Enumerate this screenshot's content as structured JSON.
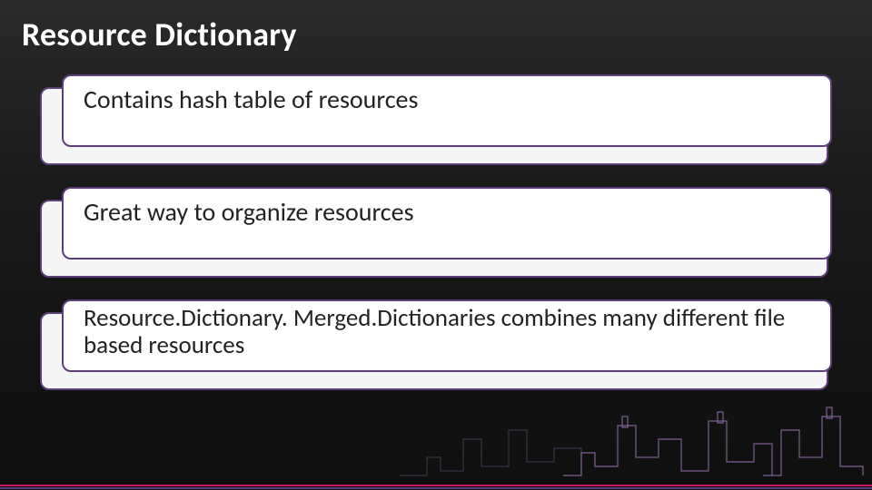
{
  "title": "Resource Dictionary",
  "bullets": [
    {
      "text": "Contains hash table of resources"
    },
    {
      "text": "Great way to organize resources"
    },
    {
      "text": "Resource.Dictionary. Merged.Dictionaries combines many different file based resources"
    }
  ],
  "colors": {
    "accent_purple": "#5d4079",
    "accent_magenta": "#c21d63",
    "background_dark": "#1a1a1a",
    "text_light": "#ffffff",
    "text_dark": "#222222",
    "bullet_bg": "#ffffff",
    "bullet_back_bg": "#f5f5f5"
  }
}
